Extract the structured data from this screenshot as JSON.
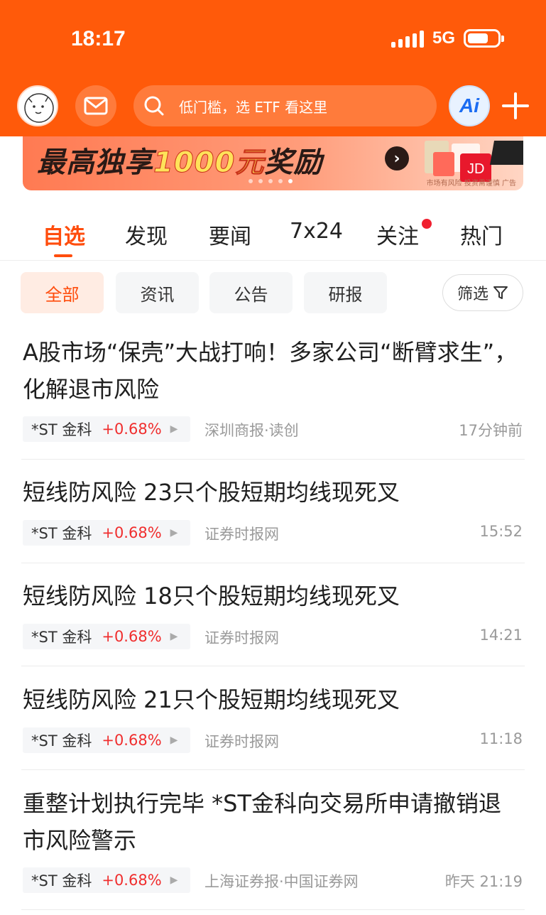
{
  "status_bar": {
    "time": "18:17",
    "network": "5G"
  },
  "header": {
    "search_placeholder": "低门槛，选 ETF 看这里",
    "ai_label": "Ai"
  },
  "banner": {
    "text_prefix": "最高独享",
    "text_highlight": "1000元",
    "text_suffix": "奖励",
    "disclaimer": "市场有风险 投资需谨慎 广告"
  },
  "tabs": [
    {
      "label": "自选",
      "active": true
    },
    {
      "label": "发现"
    },
    {
      "label": "要闻"
    },
    {
      "label": "7x24"
    },
    {
      "label": "关注",
      "badge": true
    },
    {
      "label": "热门"
    }
  ],
  "filters": {
    "chips": [
      {
        "label": "全部",
        "active": true
      },
      {
        "label": "资讯"
      },
      {
        "label": "公告"
      },
      {
        "label": "研报"
      }
    ],
    "filter_label": "筛选"
  },
  "news": [
    {
      "title": "A股市场“保壳”大战打响！多家公司“断臂求生”，化解退市风险",
      "stock": "*ST 金科",
      "change": "+0.68%",
      "source": "深圳商报·读创",
      "time": "17分钟前"
    },
    {
      "title": "短线防风险 23只个股短期均线现死叉",
      "stock": "*ST 金科",
      "change": "+0.68%",
      "source": "证券时报网",
      "time": "15:52"
    },
    {
      "title": "短线防风险 18只个股短期均线现死叉",
      "stock": "*ST 金科",
      "change": "+0.68%",
      "source": "证券时报网",
      "time": "14:21"
    },
    {
      "title": "短线防风险 21只个股短期均线现死叉",
      "stock": "*ST 金科",
      "change": "+0.68%",
      "source": "证券时报网",
      "time": "11:18"
    },
    {
      "title": "重整计划执行完毕 *ST金科向交易所申请撤销退市风险警示",
      "stock": "*ST 金科",
      "change": "+0.68%",
      "source": "上海证券报·中国证券网",
      "time": "昨天 21:19"
    }
  ],
  "colors": {
    "brand_orange": "#ff5a0a",
    "accent": "#ff4d0d",
    "rise_red": "#f02e2e"
  }
}
